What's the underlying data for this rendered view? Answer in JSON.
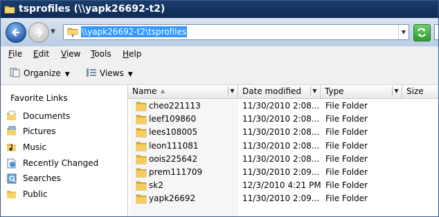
{
  "window": {
    "title": "tsprofiles (\\\\yapk26692-t2)"
  },
  "address_bar": {
    "path": "\\\\yapk26692-t2\\tsprofiles"
  },
  "menu": [
    {
      "label": "File",
      "accel": "F",
      "rest": "ile"
    },
    {
      "label": "Edit",
      "accel": "E",
      "rest": "dit"
    },
    {
      "label": "View",
      "accel": "V",
      "rest": "iew"
    },
    {
      "label": "Tools",
      "accel": "T",
      "rest": "ools"
    },
    {
      "label": "Help",
      "accel": "H",
      "rest": "elp"
    }
  ],
  "toolbar": {
    "organize": "Organize",
    "views": "Views"
  },
  "nav": {
    "title": "Favorite Links",
    "items": [
      {
        "label": "Documents",
        "icon": "documents-folder-icon"
      },
      {
        "label": "Pictures",
        "icon": "pictures-folder-icon"
      },
      {
        "label": "Music",
        "icon": "music-folder-icon"
      },
      {
        "label": "Recently Changed",
        "icon": "recently-changed-icon"
      },
      {
        "label": "Searches",
        "icon": "searches-icon"
      },
      {
        "label": "Public",
        "icon": "public-folder-icon"
      }
    ]
  },
  "columns": {
    "name": "Name",
    "date": "Date modified",
    "type": "Type",
    "size": "Size"
  },
  "files": [
    {
      "name": "cheo221113",
      "date": "11/30/2010 2:08...",
      "type": "File Folder"
    },
    {
      "name": "leef109860",
      "date": "11/30/2010 2:08...",
      "type": "File Folder"
    },
    {
      "name": "lees108005",
      "date": "11/30/2010 2:08...",
      "type": "File Folder"
    },
    {
      "name": "leon111081",
      "date": "11/30/2010 2:08...",
      "type": "File Folder"
    },
    {
      "name": "oois225642",
      "date": "11/30/2010 2:08...",
      "type": "File Folder"
    },
    {
      "name": "prem111709",
      "date": "11/30/2010 2:09...",
      "type": "File Folder"
    },
    {
      "name": "sk2",
      "date": "12/3/2010 4:21 PM",
      "type": "File Folder"
    },
    {
      "name": "yapk26692",
      "date": "11/30/2010 2:09...",
      "type": "File Folder"
    }
  ],
  "colors": {
    "titlebar": "#0f2a55",
    "selection": "#3399ff",
    "folder": "#f2c04a"
  }
}
